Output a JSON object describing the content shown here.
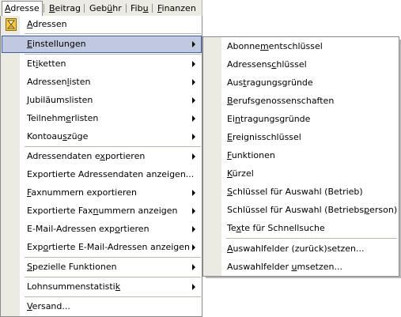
{
  "menubar": {
    "items": [
      {
        "pre": "",
        "key": "A",
        "post": "dresse"
      },
      {
        "pre": "",
        "key": "B",
        "post": "eitrag"
      },
      {
        "pre": "Geb",
        "key": "ü",
        "post": "hr"
      },
      {
        "pre": "Fib",
        "key": "u",
        "post": ""
      },
      {
        "pre": "",
        "key": "F",
        "post": "inanzen"
      }
    ]
  },
  "menu": {
    "items": [
      {
        "pre": "",
        "key": "A",
        "post": "dressen"
      },
      {
        "pre": "",
        "key": "E",
        "post": "instellungen"
      },
      {
        "pre": "Et",
        "key": "i",
        "post": "ketten"
      },
      {
        "pre": "Adressen",
        "key": "l",
        "post": "isten"
      },
      {
        "pre": "",
        "key": "J",
        "post": "ubiläumslisten"
      },
      {
        "pre": "Teilnehm",
        "key": "e",
        "post": "rlisten"
      },
      {
        "pre": "Kontoau",
        "key": "s",
        "post": "züge"
      },
      {
        "pre": "Adressendaten e",
        "key": "x",
        "post": "portieren"
      },
      {
        "pre": "Exportierte Adressendaten anzeigen...",
        "key": "",
        "post": ""
      },
      {
        "pre": "",
        "key": "F",
        "post": "axnummern exportieren"
      },
      {
        "pre": "Exportierte Fax",
        "key": "n",
        "post": "ummern anzeigen"
      },
      {
        "pre": "E-Mail-Adressen exp",
        "key": "o",
        "post": "rtieren"
      },
      {
        "pre": "Exp",
        "key": "o",
        "post": "rtierte E-Mail-Adressen anzeigen"
      },
      {
        "pre": "",
        "key": "S",
        "post": "pezielle Funktionen"
      },
      {
        "pre": "Lohnsummenstatisti",
        "key": "k",
        "post": ""
      },
      {
        "pre": "",
        "key": "V",
        "post": "ersand..."
      }
    ]
  },
  "submenu": {
    "items": [
      {
        "pre": "Abonne",
        "key": "m",
        "post": "entschlüssel"
      },
      {
        "pre": "Adressens",
        "key": "c",
        "post": "hlüssel"
      },
      {
        "pre": "Aus",
        "key": "t",
        "post": "ragungsgründe"
      },
      {
        "pre": "",
        "key": "B",
        "post": "erufsgenossenschaften"
      },
      {
        "pre": "Ei",
        "key": "n",
        "post": "tragungsgründe"
      },
      {
        "pre": "",
        "key": "E",
        "post": "reignisschlüssel"
      },
      {
        "pre": "",
        "key": "F",
        "post": "unktionen"
      },
      {
        "pre": "",
        "key": "K",
        "post": "ürzel"
      },
      {
        "pre": "",
        "key": "S",
        "post": "chlüssel für Auswahl (Betrieb)"
      },
      {
        "pre": "Schlüssel für Auswahl (Betriebs",
        "key": "p",
        "post": "erson)"
      },
      {
        "pre": "Te",
        "key": "x",
        "post": "te für Schnellsuche"
      },
      {
        "pre": "",
        "key": "A",
        "post": "uswahlfelder (zurück)setzen..."
      },
      {
        "pre": "Auswahlfelder ",
        "key": "u",
        "post": "msetzen..."
      }
    ]
  },
  "colors": {
    "highlight": "#c1c9e0",
    "highlight_border": "#3b5fa6",
    "gutter": "#ecebe3"
  },
  "icons": {
    "menu_first_item": "hourglass-icon"
  }
}
